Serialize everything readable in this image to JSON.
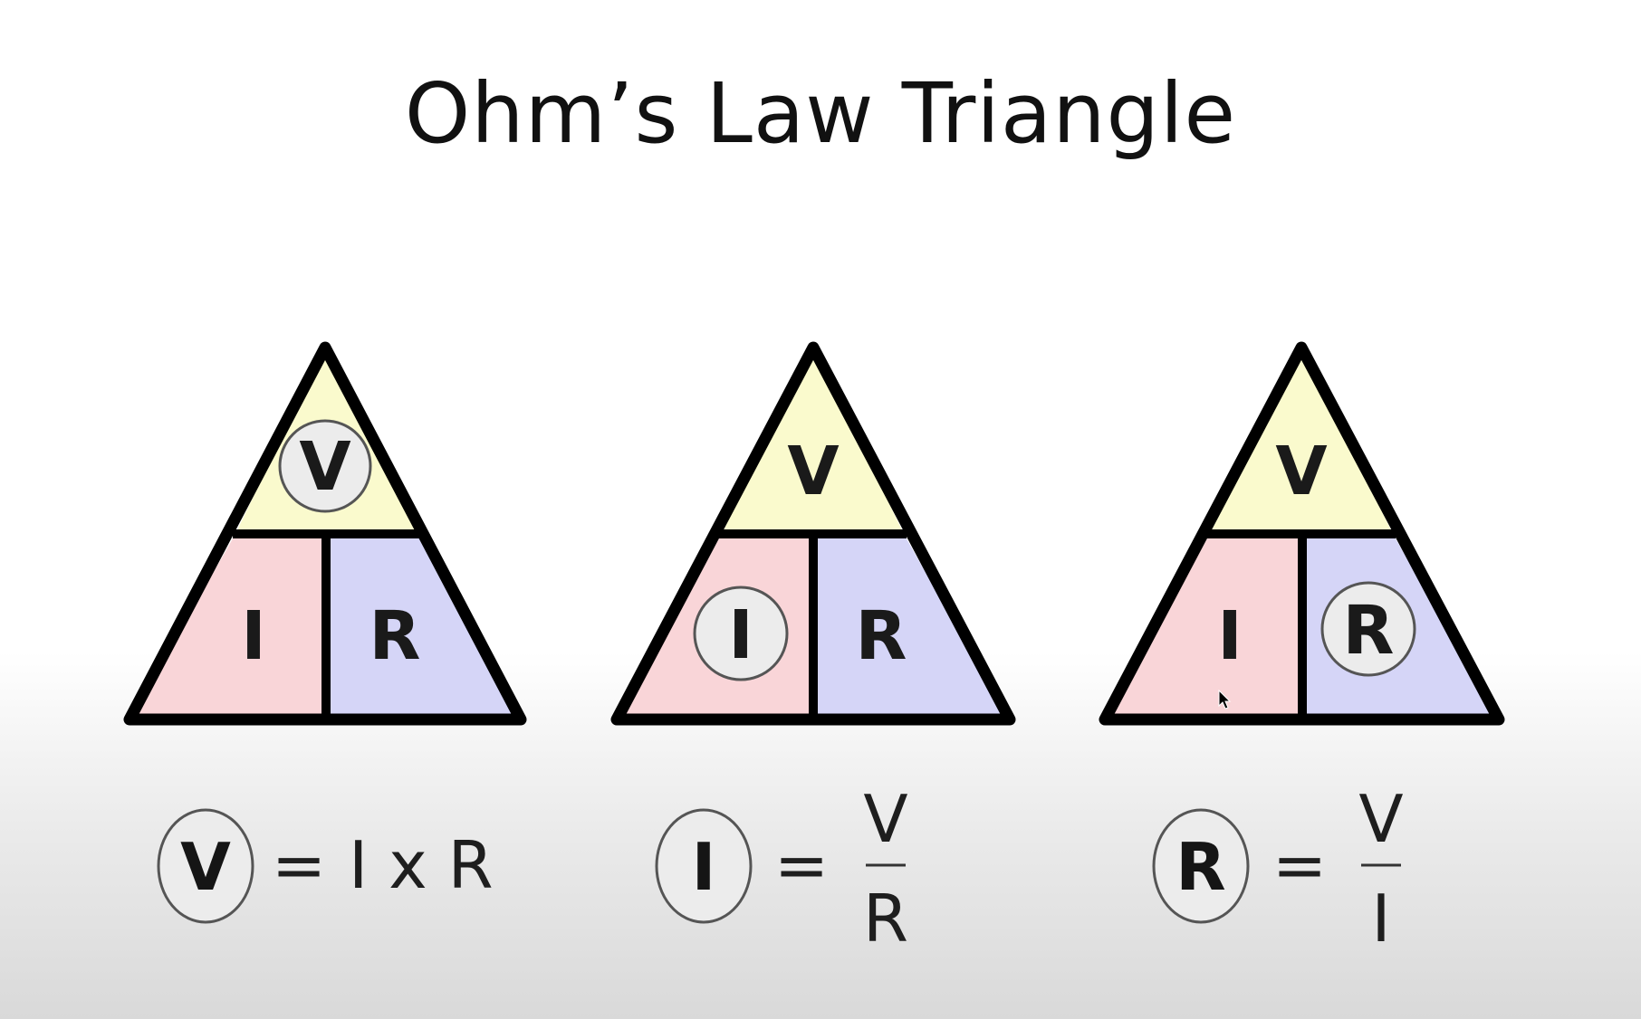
{
  "title": "Ohm’s Law Triangle",
  "colors": {
    "top_fill": "#fafacd",
    "left_fill": "#f9d5d8",
    "right_fill": "#d5d5f7",
    "outline": "#000000",
    "highlight_circle": "#ececec"
  },
  "triangles": [
    {
      "top": "V",
      "left": "I",
      "right": "R",
      "highlighted": "V"
    },
    {
      "top": "V",
      "left": "I",
      "right": "R",
      "highlighted": "I"
    },
    {
      "top": "V",
      "left": "I",
      "right": "R",
      "highlighted": "R"
    }
  ],
  "formulas": [
    {
      "subject": "V",
      "equals": "=",
      "rhs": "I x R"
    },
    {
      "subject": "I",
      "equals": "=",
      "numerator": "V",
      "denominator": "R"
    },
    {
      "subject": "R",
      "equals": "=",
      "numerator": "V",
      "denominator": "I"
    }
  ]
}
